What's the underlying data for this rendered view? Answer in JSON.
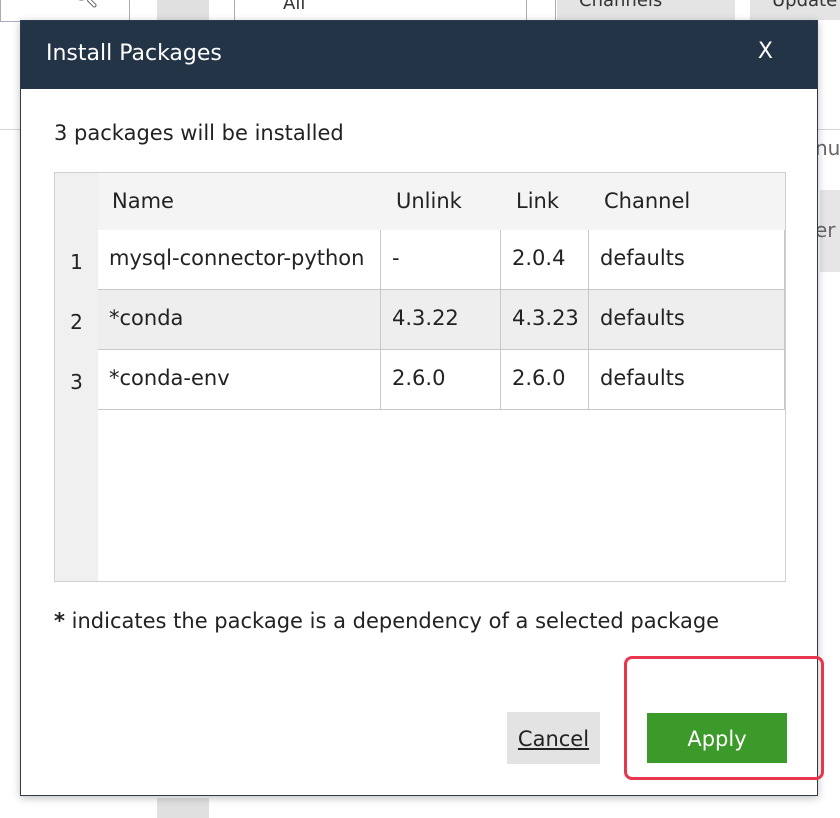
{
  "background": {
    "filter_value": "All",
    "channels_label": "Channels",
    "update_label": "Update",
    "side_text_1": "nu",
    "side_text_2": "er"
  },
  "dialog": {
    "title": "Install Packages",
    "close_label": "X",
    "summary": "3 packages will be installed",
    "columns": [
      "Name",
      "Unlink",
      "Link",
      "Channel"
    ],
    "rows": [
      {
        "index": "1",
        "name": "mysql-connector-python",
        "unlink": "-",
        "link": "2.0.4",
        "channel": "defaults"
      },
      {
        "index": "2",
        "name": "*conda",
        "unlink": "4.3.22",
        "link": "4.3.23",
        "channel": "defaults"
      },
      {
        "index": "3",
        "name": "*conda-env",
        "unlink": "2.6.0",
        "link": "2.6.0",
        "channel": "defaults"
      }
    ],
    "footnote_star": "*",
    "footnote_text": " indicates the package is a dependency of a selected package",
    "cancel_label": "Cancel",
    "apply_label": "Apply"
  },
  "colors": {
    "header_bg": "#243447",
    "apply_bg": "#3c9a2a",
    "highlight": "#e8364e"
  }
}
